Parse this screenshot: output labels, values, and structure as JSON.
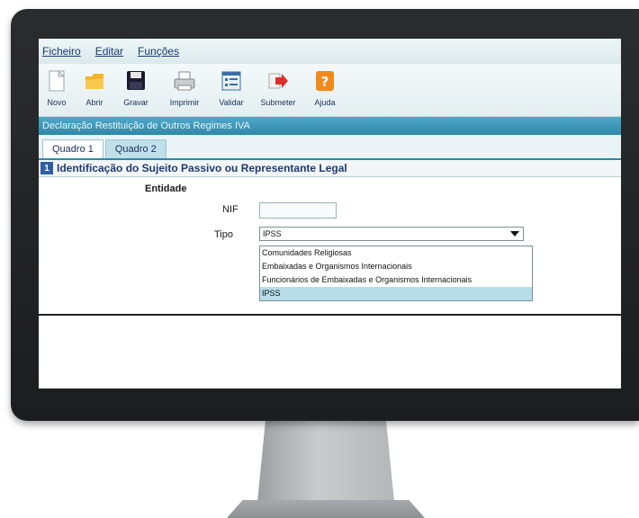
{
  "menu": [
    "Ficheiro",
    "Editar",
    "Funções"
  ],
  "toolbar": [
    {
      "label": "Novo",
      "icon": "new-document-icon"
    },
    {
      "label": "Abrir",
      "icon": "folder-open-icon"
    },
    {
      "label": "Gravar",
      "icon": "save-icon"
    },
    {
      "label": "Imprimir",
      "icon": "printer-icon"
    },
    {
      "label": "Validar",
      "icon": "validate-checklist-icon"
    },
    {
      "label": "Submeter",
      "icon": "submit-arrow-icon"
    },
    {
      "label": "Ajuda",
      "icon": "help-icon"
    }
  ],
  "form_title": "Declaração Restituição de Outros Regimes IVA",
  "tabs": [
    "Quadro 1",
    "Quadro 2"
  ],
  "section": {
    "number": "1",
    "title": "Identificação do Sujeito Passivo ou Representante Legal"
  },
  "form": {
    "entidade_label": "Entidade",
    "nif_label": "NIF",
    "nif_value": "",
    "tipo_label": "Tipo",
    "tipo_value": "IPSS",
    "tipo_options": [
      "Comunidades Religiosas",
      "Embaixadas e Organismos Internacionais",
      "Funcionários de Embaixadas e Organismos Internacionais",
      "IPSS"
    ]
  },
  "colors": {
    "title_bar": "#2f87aa",
    "accent": "#1f3a72",
    "selected_option": "#b7dde9"
  }
}
